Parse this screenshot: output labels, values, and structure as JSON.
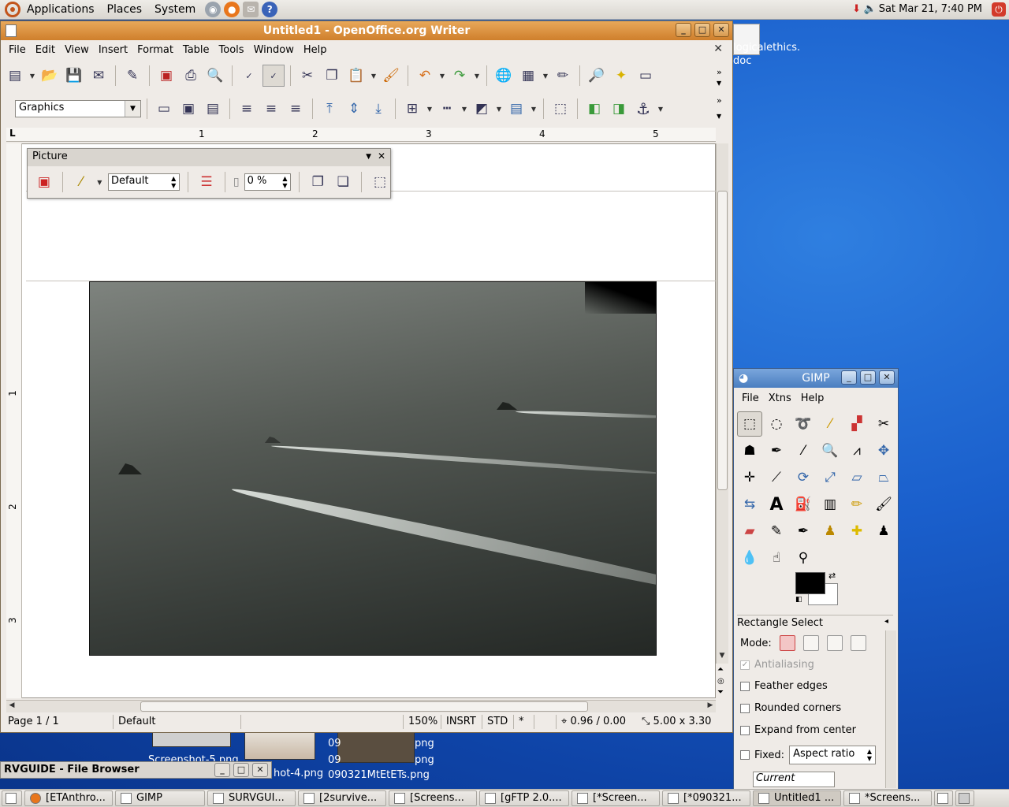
{
  "top_panel": {
    "menus": [
      "Applications",
      "Places",
      "System"
    ],
    "clock": "Sat Mar 21,  7:40 PM"
  },
  "desktop": {
    "file_label": "logicalethics.\ndoc"
  },
  "writer": {
    "title": "Untitled1 - OpenOffice.org Writer",
    "menus": [
      "File",
      "Edit",
      "View",
      "Insert",
      "Format",
      "Table",
      "Tools",
      "Window",
      "Help"
    ],
    "style_box": "Graphics",
    "ruler_h": [
      "1",
      "2",
      "3",
      "4",
      "5"
    ],
    "ruler_v": [
      "1",
      "2",
      "3"
    ],
    "status": {
      "page": "Page 1 / 1",
      "style": "Default",
      "zoom": "150%",
      "insert_mode": "INSRT",
      "selection_mode": "STD",
      "modified": "*",
      "position": "0.96 / 0.00",
      "size": "5.00 x 3.30"
    }
  },
  "picture_toolbar": {
    "title": "Picture",
    "graphics_mode": "Default",
    "transparency": "0 %"
  },
  "gimp": {
    "title": "GIMP",
    "menus": [
      "File",
      "Xtns",
      "Help"
    ],
    "tool_options_title": "Rectangle Select",
    "mode_label": "Mode:",
    "antialiasing": "Antialiasing",
    "feather": "Feather edges",
    "rounded": "Rounded corners",
    "expand": "Expand from center",
    "fixed": "Fixed:",
    "fixed_select": "Aspect ratio",
    "current": "Current"
  },
  "file_browser": {
    "title": "RVGUIDE - File Browser",
    "thumbs": [
      "Screenshot-5.png",
      "hot-4.png",
      "090321MtEtETs.png",
      "png",
      "png",
      "09",
      "09"
    ]
  },
  "taskbar": {
    "items": [
      "[ETAnthro...",
      "GIMP",
      "SURVGUI...",
      "[2survive...",
      "[Screens...",
      "[gFTP 2.0....",
      "[*Screen...",
      "[*090321...",
      "Untitled1 ...",
      "*Screens..."
    ]
  }
}
